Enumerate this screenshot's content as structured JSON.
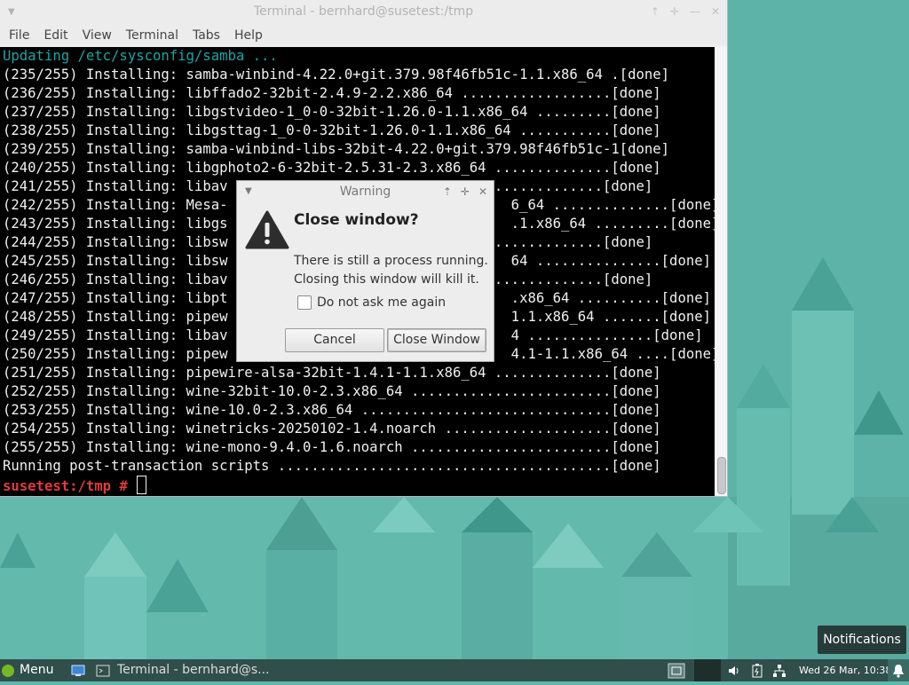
{
  "terminal": {
    "title": "Terminal - bernhard@susetest:/tmp",
    "menu": [
      "File",
      "Edit",
      "View",
      "Terminal",
      "Tabs",
      "Help"
    ],
    "lines": [
      "Updating /etc/sysconfig/samba ...",
      "(235/255) Installing: samba-winbind-4.22.0+git.379.98f46fb51c-1.1.x86_64 .[done]",
      "(236/255) Installing: libffado2-32bit-2.4.9-2.2.x86_64 ..................[done]",
      "(237/255) Installing: libgstvideo-1_0-0-32bit-1.26.0-1.1.x86_64 .........[done]",
      "(238/255) Installing: libgsttag-1_0-0-32bit-1.26.0-1.1.x86_64 ...........[done]",
      "(239/255) Installing: samba-winbind-libs-32bit-4.22.0+git.379.98f46fb51c-1[done]",
      "(240/255) Installing: libgphoto2-6-32bit-2.5.31-2.3.x86_64 ..............[done]",
      "(241/255) Installing: libav ............................................[done]",
      "(242/255) Installing: Mesa-                                  6_64 ..............[done]",
      "(243/255) Installing: libgs                                  .1.x86_64 .........[done]",
      "(244/255) Installing: libsw ............................................[done]",
      "(245/255) Installing: libsw                                  64 ...............[done]",
      "(246/255) Installing: libav ............................................[done]",
      "(247/255) Installing: libpt                                  .x86_64 ..........[done]",
      "(248/255) Installing: pipew                                  1.1.x86_64 .......[done]",
      "(249/255) Installing: libav                                  4 ...............[done]",
      "(250/255) Installing: pipew                                  4.1-1.1.x86_64 ....[done]",
      "(251/255) Installing: pipewire-alsa-32bit-1.4.1-1.1.x86_64 ..............[done]",
      "(252/255) Installing: wine-32bit-10.0-2.3.x86_64 ........................[done]",
      "(253/255) Installing: wine-10.0-2.3.x86_64 ..............................[done]",
      "(254/255) Installing: winetricks-20250102-1.4.noarch ....................[done]",
      "(255/255) Installing: wine-mono-9.4.0-1.6.noarch ........................[done]",
      "Running post-transaction scripts ........................................[done]"
    ],
    "prompt": "susetest:/tmp #"
  },
  "dialog": {
    "title": "Warning",
    "heading": "Close window?",
    "message_line1": "There is still a process running.",
    "message_line2": "Closing this window will kill it.",
    "checkbox_label": "Do not ask me again",
    "checkbox_checked": false,
    "cancel_label": "Cancel",
    "close_label": "Close Window"
  },
  "notifications_label": "Notifications",
  "taskbar": {
    "menu_label": "Menu",
    "window_label": "Terminal - bernhard@s...",
    "clock": "Wed 26 Mar, 10:38"
  },
  "icons": {
    "warning": "warning-triangle-icon",
    "app_menu": "geeko-icon",
    "volume": "volume-icon",
    "battery": "battery-icon",
    "network": "network-icon",
    "bell": "bell-icon"
  },
  "colors": {
    "desktop_bg": "#5fb8ad",
    "taskbar_bg": "#304e4a",
    "prompt_red": "#e03c3c",
    "cyan_text": "#17a6a6"
  }
}
